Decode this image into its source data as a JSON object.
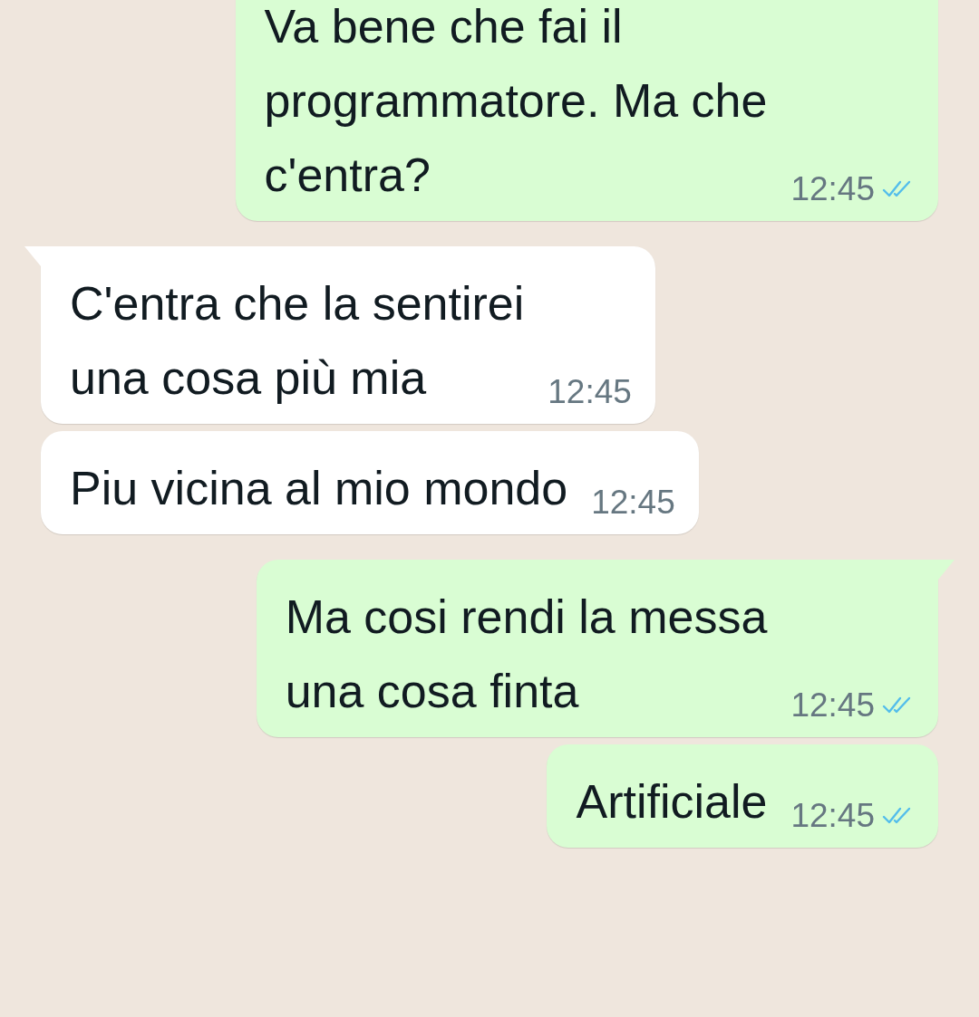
{
  "messages": [
    {
      "outgoing": true,
      "tail": false,
      "text": "Va bene che fai il\nprogrammatore. Ma che\nc'entra?",
      "time": "12:45",
      "read": true
    },
    {
      "outgoing": false,
      "tail": true,
      "text": "C'entra che la sentirei\nuna cosa più mia",
      "time": "12:45"
    },
    {
      "outgoing": false,
      "tail": false,
      "text": "Piu vicina al mio mondo",
      "time": "12:45"
    },
    {
      "outgoing": true,
      "tail": true,
      "text": "Ma cosi rendi la messa\nuna cosa finta",
      "time": "12:45",
      "read": true
    },
    {
      "outgoing": true,
      "tail": false,
      "text": "Artificiale",
      "time": "12:45",
      "read": true
    }
  ]
}
